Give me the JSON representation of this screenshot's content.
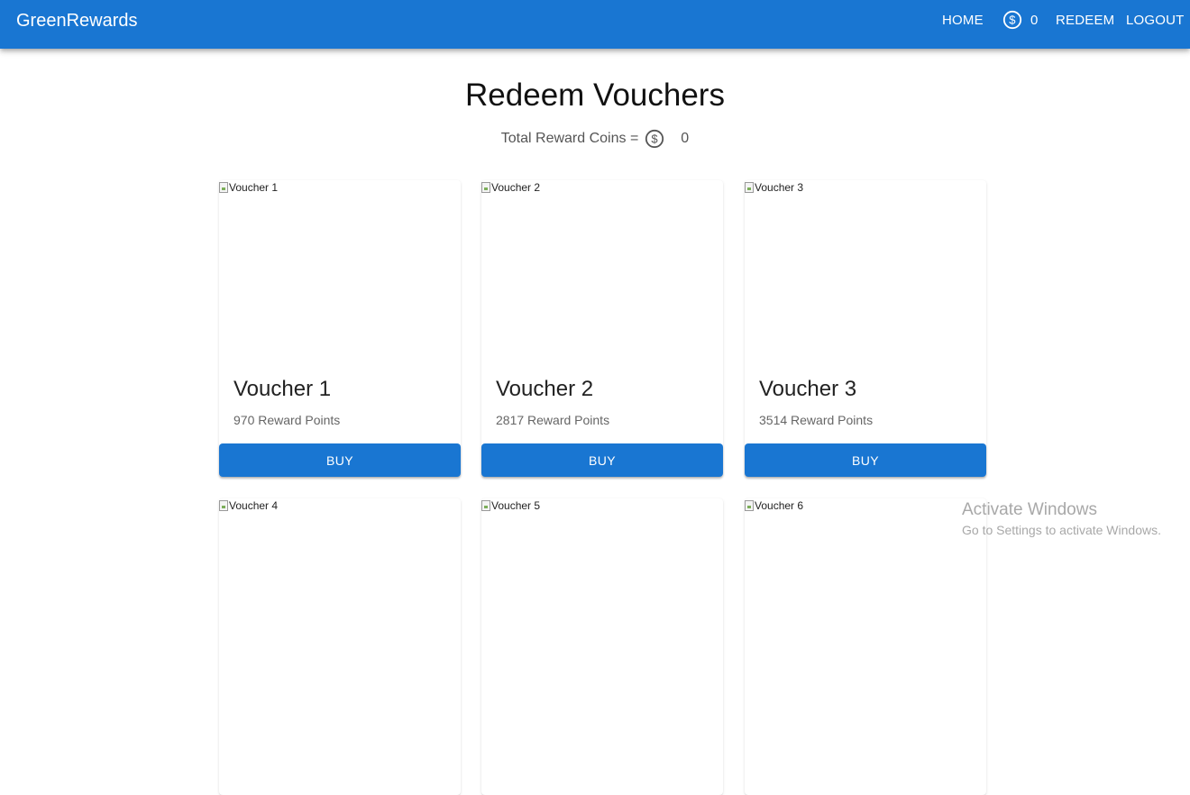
{
  "appbar": {
    "brand": "GreenRewards",
    "nav": {
      "home": "HOME",
      "coins": "0",
      "redeem": "REDEEM",
      "logout": "LOGOUT"
    },
    "color": "#1976d2"
  },
  "main": {
    "title": "Redeem Vouchers",
    "total_label": "Total Reward Coins =",
    "total_value": "0"
  },
  "vouchers": [
    {
      "alt": "Voucher 1",
      "title": "Voucher 1",
      "points": "970 Reward Points",
      "button": "BUY"
    },
    {
      "alt": "Voucher 2",
      "title": "Voucher 2",
      "points": "2817 Reward Points",
      "button": "BUY"
    },
    {
      "alt": "Voucher 3",
      "title": "Voucher 3",
      "points": "3514 Reward Points",
      "button": "BUY"
    },
    {
      "alt": "Voucher 4"
    },
    {
      "alt": "Voucher 5"
    },
    {
      "alt": "Voucher 6"
    }
  ],
  "watermark": {
    "title": "Activate Windows",
    "subtitle": "Go to Settings to activate Windows."
  },
  "icons": {
    "coin": "dollar-circle-icon",
    "broken_image": "broken-image-icon"
  }
}
